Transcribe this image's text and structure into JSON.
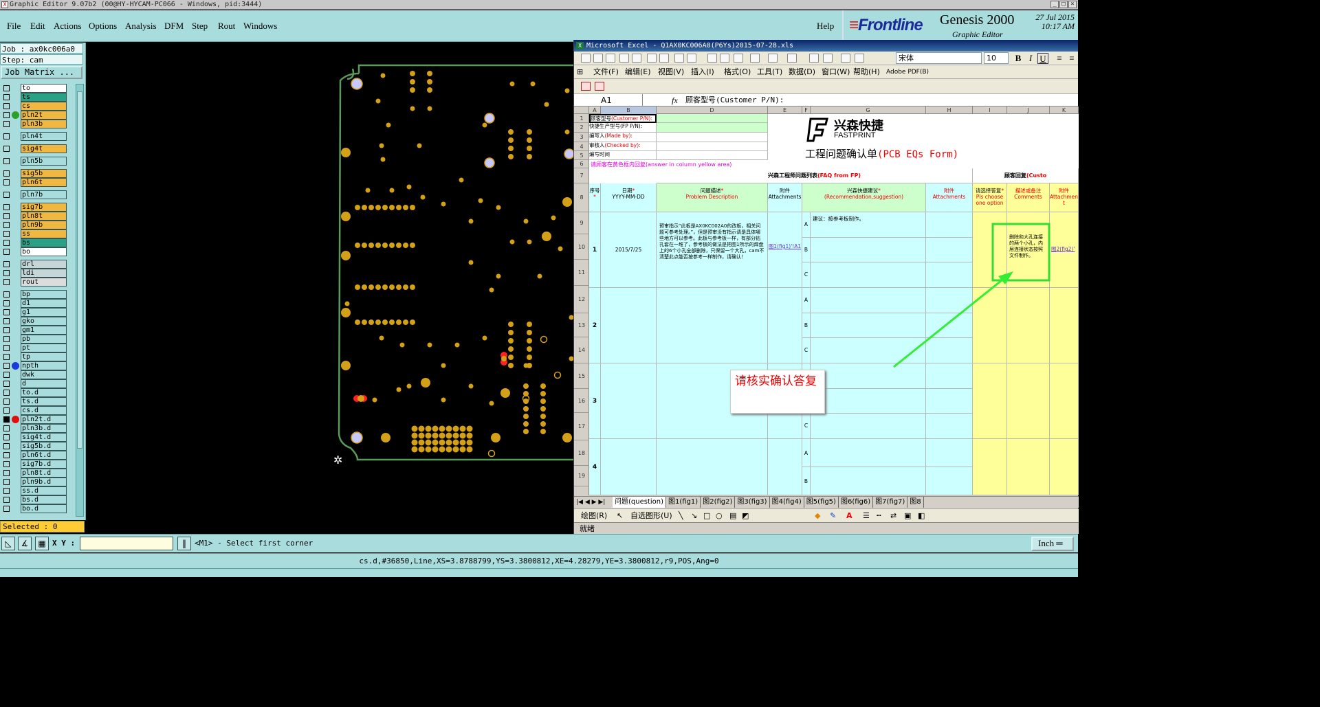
{
  "window_title": "Graphic Editor 9.07b2 (00@HY-HYCAM-PC066 - Windows, pid:3444)",
  "menu": [
    "File",
    "Edit",
    "Actions",
    "Options",
    "Analysis",
    "DFM",
    "Step",
    "Rout",
    "Windows"
  ],
  "help_label": "Help",
  "brand": {
    "logo": "Frontline",
    "product": "Genesis 2000",
    "subtitle": "Graphic Editor",
    "date": "27 Jul 2015",
    "time": "10:17 AM"
  },
  "job_line": "Job : ax0kc006a0",
  "step_line": "Step: cam",
  "job_matrix_label": "Job Matrix ...",
  "layers": [
    {
      "name": "to",
      "color": "white",
      "gap": false
    },
    {
      "name": "ts",
      "color": "green",
      "gap": false
    },
    {
      "name": "cs",
      "color": "orange",
      "gap": false
    },
    {
      "name": "pln2t",
      "color": "orange",
      "gap": false,
      "dot": "#2aa02a"
    },
    {
      "name": "pln3b",
      "color": "orange",
      "gap": false
    },
    {
      "name": "pln4t",
      "color": "cyan",
      "gap": true
    },
    {
      "name": "sig4t",
      "color": "orange",
      "gap": true
    },
    {
      "name": "pln5b",
      "color": "cyan",
      "gap": true
    },
    {
      "name": "sig5b",
      "color": "orange",
      "gap": true
    },
    {
      "name": "pln6t",
      "color": "orange",
      "gap": false
    },
    {
      "name": "pln7b",
      "color": "cyan",
      "gap": true
    },
    {
      "name": "sig7b",
      "color": "orange",
      "gap": true
    },
    {
      "name": "pln8t",
      "color": "orange",
      "gap": false
    },
    {
      "name": "pln9b",
      "color": "orange",
      "gap": false
    },
    {
      "name": "ss",
      "color": "orange",
      "gap": false
    },
    {
      "name": "bs",
      "color": "green",
      "gap": false
    },
    {
      "name": "bo",
      "color": "white",
      "gap": false
    },
    {
      "name": "drl",
      "color": "grey",
      "gap": true
    },
    {
      "name": "ldi",
      "color": "grey",
      "gap": false
    },
    {
      "name": "rout",
      "color": "light",
      "gap": false
    },
    {
      "name": "bp",
      "color": "cyan",
      "gap": true
    },
    {
      "name": "d1",
      "color": "cyan",
      "gap": false
    },
    {
      "name": "g1",
      "color": "cyan",
      "gap": false
    },
    {
      "name": "gko",
      "color": "cyan",
      "gap": false
    },
    {
      "name": "gm1",
      "color": "cyan",
      "gap": false
    },
    {
      "name": "pb",
      "color": "cyan",
      "gap": false
    },
    {
      "name": "pt",
      "color": "cyan",
      "gap": false
    },
    {
      "name": "tp",
      "color": "cyan",
      "gap": false
    },
    {
      "name": "npth",
      "color": "cyan",
      "gap": false,
      "dot": "#1a3adc"
    },
    {
      "name": "dwk",
      "color": "cyan",
      "gap": false
    },
    {
      "name": "d",
      "color": "cyan",
      "gap": false
    },
    {
      "name": "to.d",
      "color": "cyan",
      "gap": false
    },
    {
      "name": "ts.d",
      "color": "cyan",
      "gap": false
    },
    {
      "name": "cs.d",
      "color": "cyan",
      "gap": false
    },
    {
      "name": "pln2t.d",
      "color": "cyan",
      "gap": false,
      "dot": "#e01010",
      "checked": true
    },
    {
      "name": "pln3b.d",
      "color": "cyan",
      "gap": false
    },
    {
      "name": "sig4t.d",
      "color": "cyan",
      "gap": false
    },
    {
      "name": "sig5b.d",
      "color": "cyan",
      "gap": false
    },
    {
      "name": "pln6t.d",
      "color": "cyan",
      "gap": false
    },
    {
      "name": "sig7b.d",
      "color": "cyan",
      "gap": false
    },
    {
      "name": "pln8t.d",
      "color": "cyan",
      "gap": false
    },
    {
      "name": "pln9b.d",
      "color": "cyan",
      "gap": false
    },
    {
      "name": "ss.d",
      "color": "cyan",
      "gap": false
    },
    {
      "name": "bs.d",
      "color": "cyan",
      "gap": false
    },
    {
      "name": "bo.d",
      "color": "cyan",
      "gap": false
    }
  ],
  "selected_label": "Selected : 0",
  "xy_label": "X Y :",
  "xy_value": "",
  "prompt": "<M1> - Select first corner",
  "units_label": "Inch",
  "status_line": "cs.d,#36850,Line,XS=3.8788799,YS=3.3800812,XE=4.28279,YE=3.3800812,r9,POS,Ang=0",
  "excel": {
    "title": "Microsoft Excel - Q1AX0KC006A0(P6Ys)2015-07-28.xls",
    "menu": [
      "文件(F)",
      "编辑(E)",
      "视图(V)",
      "插入(I)",
      "格式(O)",
      "工具(T)",
      "数据(D)",
      "窗口(W)",
      "帮助(H)",
      "Adobe PDF(B)"
    ],
    "font_name": "宋体",
    "font_size": "10",
    "name_box": "A1",
    "fx": "fx",
    "formula": "顾客型号(Customer P/N):",
    "columns": [
      "A",
      "B",
      "D",
      "E",
      "F",
      "G",
      "H",
      "I",
      "J",
      "K"
    ],
    "rows": [
      "1",
      "2",
      "3",
      "4",
      "5",
      "6",
      "7",
      "8",
      "9",
      "10",
      "11",
      "12",
      "13",
      "14",
      "15",
      "16",
      "17",
      "18",
      "19"
    ],
    "info_labels": [
      {
        "cn": "顾客型号",
        "en": "(Customer P/N):"
      },
      {
        "cn": "快捷生产型号",
        "en": "(FP P/N):"
      },
      {
        "cn": "编写人",
        "en": "(Made by):"
      },
      {
        "cn": "审核人",
        "en": "(Checked by):"
      },
      {
        "cn": "编写时间",
        "en": ""
      }
    ],
    "logo_cn": "兴森快捷",
    "logo_en": "FASTPRINT",
    "form_title_cn": "工程问题确认单",
    "form_title_en": "(PCB EQs Form)",
    "note_row6": "请顾客在黄色框内回复(answer in column yellow area)",
    "faq_header_cn": "兴森工程师问题列表",
    "faq_header_en": "(FAQ from FP)",
    "customer_reply_cn": "顾客回复",
    "customer_reply_en": "(Custo",
    "headers": {
      "seq": "序号",
      "date_cn": "日期",
      "date_fmt": "YYYY-MM-DD",
      "problem_cn": "问题描述",
      "problem_en": "Problem Description",
      "attach_cn": "附件",
      "attach_en": "Attachments",
      "rec_cn": "兴森快捷建议",
      "rec_en": "(Recommendation,suggestion)",
      "attach2_cn": "附件",
      "attach2_en": "Attachments",
      "choose_cn": "请选择答复",
      "choose_en": "Pls choose one option",
      "comments_cn": "描述或备注",
      "comments_en": "Comments",
      "attach3_cn": "附件",
      "attach3_en": "Attachmen t"
    },
    "issues": [
      {
        "no": "1",
        "date": "2015/7/25",
        "description": "预审指示“此板是AX0KC002A0的改板，相关问题可参考处理。”，但是预审没有指示请是具体哪些地方可以参考。此板与参考板一样，有部分钻孔套在一堆了，参考板的做法是把图1所示的焊盘上的6个小孔全部删除，只保留一个大孔，cam不清楚此点能否按参考一样制作，请确认！",
        "attachment": "图1(fig1)'!A1",
        "options": [
          "A",
          "B",
          "C"
        ],
        "recommendation_a": "建议：按参考板制作。",
        "comment": "删除和大孔连接的两个小孔，内层连接状态按照文件制作。",
        "attachment2": "图2(fig2)'"
      },
      {
        "no": "2",
        "options": [
          "A",
          "B",
          "C"
        ]
      },
      {
        "no": "3",
        "options": [
          "A",
          "B",
          "C"
        ]
      },
      {
        "no": "4",
        "options": [
          "A",
          "B"
        ]
      }
    ],
    "sheet_tabs": [
      "问题(question)",
      "图1(fig1)",
      "图2(fig2)",
      "图3(fig3)",
      "图4(fig4)",
      "图5(fig5)",
      "图6(fig6)",
      "图7(fig7)",
      "图8"
    ],
    "draw_label": "绘图(R)",
    "autoshape_label": "自选图形(U)",
    "status": "就绪"
  },
  "callout_text": "请核实确认答复",
  "colors": {
    "genesis_bg": "#a9dcdc",
    "pad_color": "#d4a017",
    "board_outline": "#5a9a5a",
    "arrow": "#33ee33",
    "highlight_box": "#33dd33"
  }
}
